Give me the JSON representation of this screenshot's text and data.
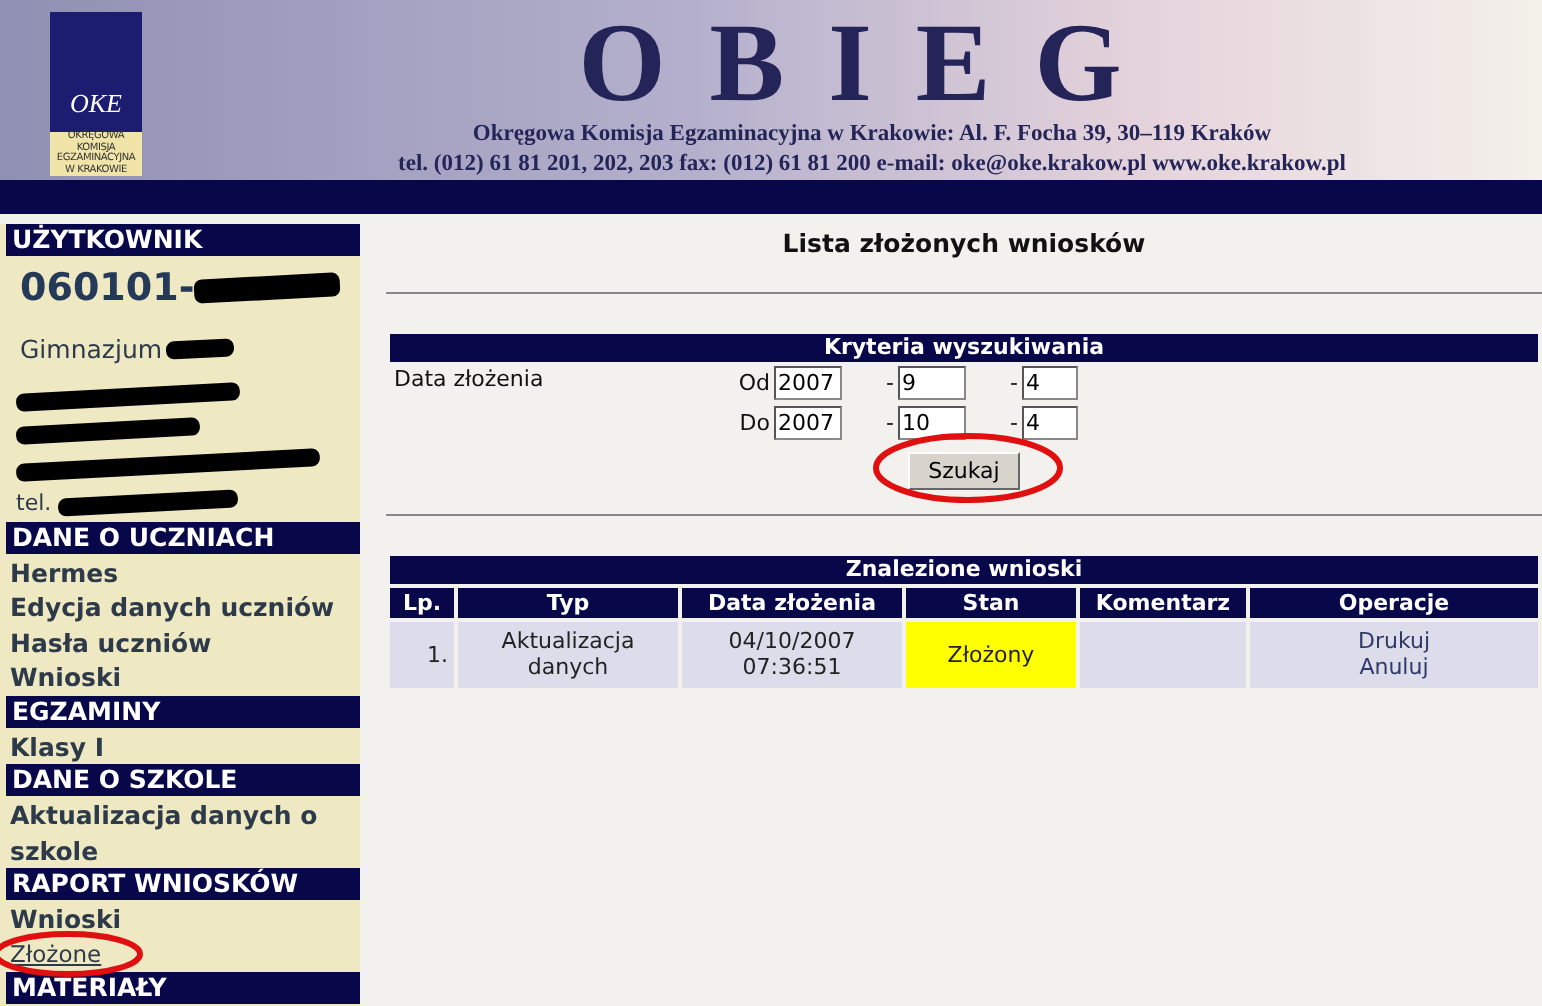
{
  "header": {
    "title": "OBIEG",
    "address": "Okręgowa Komisja Egzaminacyjna w Krakowie:  Al. F. Focha 39, 30–119 Kraków",
    "contact": "tel. (012) 61 81 201, 202, 203  fax: (012) 61 81 200  e-mail: oke@oke.krakow.pl   www.oke.krakow.pl",
    "logo_mark": "OKE",
    "logo_lines": [
      "OKRĘGOWA",
      "KOMISJA",
      "EGZAMINACYJNA",
      "W KRAKOWIE"
    ]
  },
  "user": {
    "heading": "UŻYTKOWNIK",
    "id": "060101-",
    "school": "Gimnazjum",
    "tel": "tel."
  },
  "sidebar": [
    {
      "heading": "DANE O UCZNIACH",
      "items": [
        {
          "label": "Hermes",
          "selected": false,
          "highlighted": false
        },
        {
          "label": "Edycja danych uczniów",
          "selected": false,
          "highlighted": false
        },
        {
          "label": "Hasła uczniów",
          "selected": false,
          "highlighted": false
        },
        {
          "label": "Wnioski",
          "selected": false,
          "highlighted": false
        }
      ]
    },
    {
      "heading": "EGZAMINY",
      "items": [
        {
          "label": "Klasy I",
          "selected": false,
          "highlighted": false
        }
      ]
    },
    {
      "heading": "DANE O SZKOLE",
      "items": [
        {
          "label": "Aktualizacja danych o szkole",
          "selected": false,
          "highlighted": false
        }
      ]
    },
    {
      "heading": "RAPORT WNIOSKÓW",
      "items": [
        {
          "label": "Wnioski",
          "selected": false,
          "highlighted": false
        },
        {
          "label": "Złożone",
          "selected": true,
          "highlighted": true
        }
      ]
    },
    {
      "heading": "MATERIAŁY"
    }
  ],
  "page_title": "Lista złożonych wniosków",
  "search": {
    "heading": "Kryteria wyszukiwania",
    "label": "Data złożenia",
    "separator": "-",
    "rows": [
      {
        "label": "Od",
        "year": "2007",
        "month": "9",
        "day": "4"
      },
      {
        "label": "Do",
        "year": "2007",
        "month": "10",
        "day": "4"
      }
    ],
    "button": {
      "label": "Szukaj",
      "highlighted": true
    }
  },
  "results": {
    "heading": "Znalezione wnioski",
    "columns": [
      "Lp.",
      "Typ",
      "Data złożenia",
      "Stan",
      "Komentarz",
      "Operacje"
    ],
    "rows": [
      {
        "lp": "1.",
        "type": [
          "Aktualizacja",
          "danych"
        ],
        "date": [
          "04/10/2007",
          "07:36:51"
        ],
        "status": "Złożony",
        "comment": "",
        "operations": [
          "Drukuj",
          "Anuluj"
        ]
      }
    ]
  }
}
